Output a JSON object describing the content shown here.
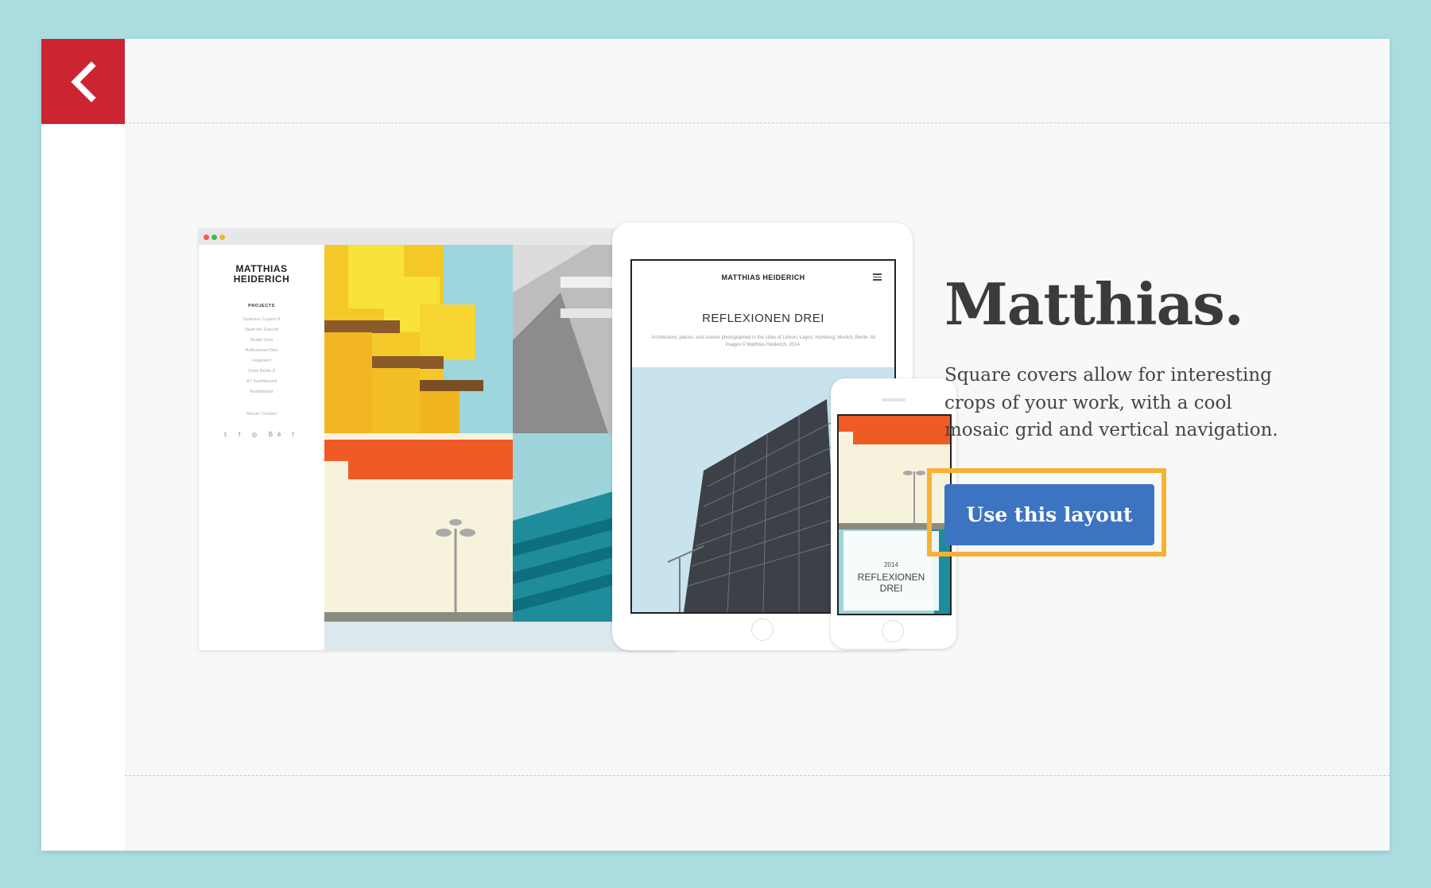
{
  "back_button": {
    "icon": "chevron-left-icon"
  },
  "preview": {
    "site_name_line1": "MATTHIAS",
    "site_name_line2": "HEIDERICH",
    "projects_heading": "PROJECTS",
    "nav_items": [
      "Systems / Layers II",
      "Stadt der Zukunft",
      "Studie Zwei",
      "Reflexionen Drei",
      "Fragment",
      "Color Berlin 3",
      "A7 Southbound",
      "Northbound"
    ],
    "about_link": "About / Contact",
    "social_icons": [
      "twitter-icon",
      "facebook-icon",
      "instagram-icon",
      "behance-icon",
      "tumblr-icon"
    ],
    "social_glyphs": [
      "𝕥",
      "f",
      "◎",
      "Bē",
      "t"
    ],
    "tablet_site_name": "MATTHIAS HEIDERICH",
    "tablet_gallery_title": "REFLEXIONEN DREI",
    "tablet_description": "Architecture, places, and scenes photographed in the cities of Lisbon, Lagos, Homburg, Munich, Berlin. All images © Matthias Heiderich, 2014.",
    "phone_year": "2014",
    "phone_title_line1": "REFLEXIONEN",
    "phone_title_line2": "DREI"
  },
  "layout": {
    "name": "Matthias.",
    "description": "Square covers allow for interesting crops of your work, with a cool mosaic grid and vertical navigation.",
    "cta_label": "Use this layout"
  },
  "colors": {
    "background": "#abdde0",
    "back_button": "#cc2531",
    "cta": "#3c74c2",
    "highlight": "#f8b136"
  }
}
